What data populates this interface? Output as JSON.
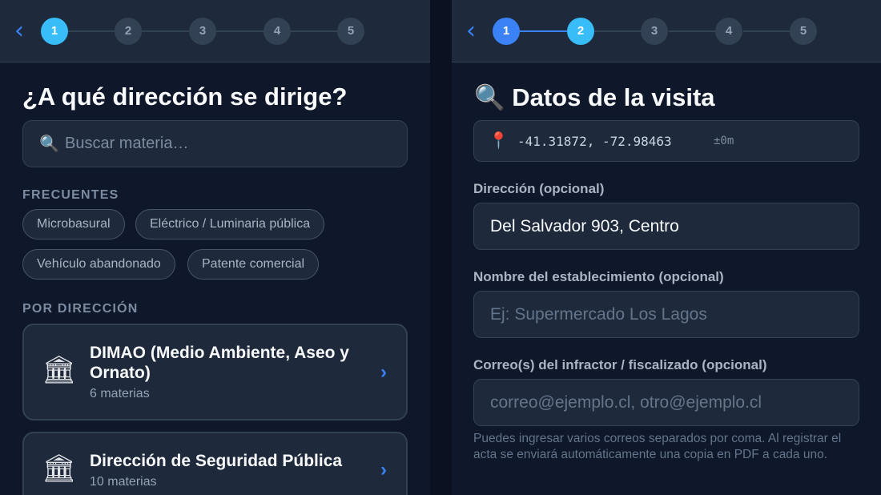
{
  "left": {
    "stepper": {
      "back_icon": "chevron-left-icon",
      "steps": [
        "1",
        "2",
        "3",
        "4",
        "5"
      ],
      "active_step": 1
    },
    "title": "¿A qué dirección se dirige?",
    "search": {
      "icon": "search-icon",
      "placeholder": "Buscar materia…"
    },
    "frequent": {
      "label": "FRECUENTES",
      "chips": [
        "Microbasural",
        "Eléctrico / Luminaria pública",
        "Vehículo abandonado",
        "Patente comercial"
      ]
    },
    "by_direction": {
      "label": "POR DIRECCIÓN",
      "cards": [
        {
          "icon": "building-icon",
          "name": "DIMAO (Medio Ambiente, Aseo y Ornato)",
          "count": "6 materias"
        },
        {
          "icon": "building-icon",
          "name": "Dirección de Seguridad Pública",
          "count": "10 materias"
        }
      ]
    }
  },
  "right": {
    "stepper": {
      "back_icon": "chevron-left-icon",
      "steps": [
        "1",
        "2",
        "3",
        "4",
        "5"
      ],
      "active_step": 2
    },
    "title_icon": "search-icon",
    "title": "Datos de la visita",
    "location": {
      "icon": "pin-icon",
      "coords": "-41.31872, -72.98463",
      "accuracy": "±0m"
    },
    "fields": {
      "address": {
        "label": "Dirección (opcional)",
        "value": "Del Salvador 903, Centro"
      },
      "establishment": {
        "label": "Nombre del establecimiento (opcional)",
        "placeholder": "Ej: Supermercado Los Lagos"
      },
      "emails": {
        "label": "Correo(s) del infractor / fiscalizado (opcional)",
        "placeholder": "correo@ejemplo.cl, otro@ejemplo.cl"
      }
    },
    "help_text": "Puedes ingresar varios correos separados por coma. Al registrar el acta se enviará automáticamente una copia en PDF a cada uno."
  },
  "colors": {
    "accent": "#3b82f6",
    "active_step": "#38bdf8",
    "panel_bg": "#0f172a",
    "card_bg": "#1e293b"
  }
}
